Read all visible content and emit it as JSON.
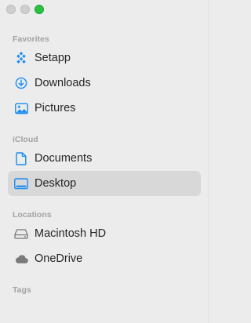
{
  "window": {
    "traffic_lights": [
      {
        "name": "close",
        "color": "#cfcfcf"
      },
      {
        "name": "minimize",
        "color": "#cfcfcf"
      },
      {
        "name": "maximize",
        "color": "#29c23f"
      }
    ]
  },
  "sidebar": {
    "accent_color": "#1a8cf0",
    "selected_bg": "#d8d8d8",
    "sections": {
      "favorites": {
        "header": "Favorites",
        "items": [
          {
            "label": "Setapp",
            "icon": "setapp-icon"
          },
          {
            "label": "Downloads",
            "icon": "downloads-icon"
          },
          {
            "label": "Pictures",
            "icon": "pictures-icon"
          }
        ]
      },
      "icloud": {
        "header": "iCloud",
        "items": [
          {
            "label": "Documents",
            "icon": "document-icon"
          },
          {
            "label": "Desktop",
            "icon": "desktop-icon",
            "selected": true
          }
        ]
      },
      "locations": {
        "header": "Locations",
        "items": [
          {
            "label": "Macintosh HD",
            "icon": "hard-drive-icon"
          },
          {
            "label": "OneDrive",
            "icon": "cloud-icon"
          }
        ]
      },
      "tags": {
        "header": "Tags"
      }
    }
  }
}
